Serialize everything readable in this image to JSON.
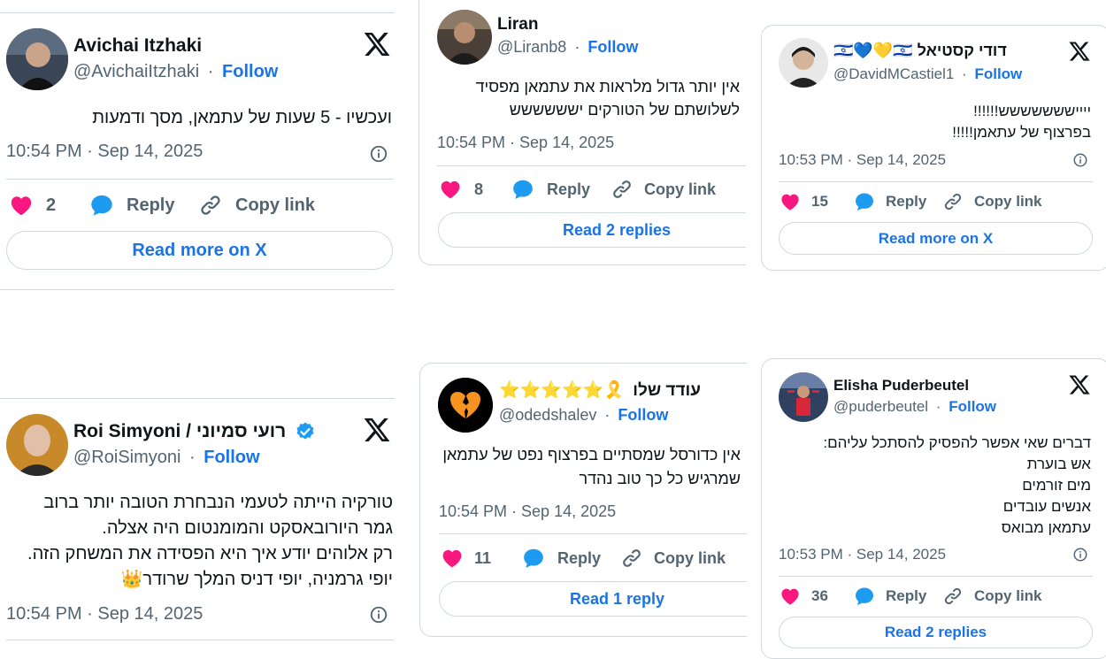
{
  "common": {
    "follow": "Follow",
    "dot": "·",
    "reply": "Reply",
    "copy_link": "Copy link"
  },
  "tweets": [
    {
      "name": "Avichai Itzhaki",
      "handle": "@AvichaiItzhaki",
      "lines": [
        "ועכשיו - 5 שעות של עתמאן, מסך ודמעות"
      ],
      "time": "10:54 PM · Sep 14, 2025",
      "likes": "2",
      "button": "Read more on X"
    },
    {
      "name": "Liran",
      "handle": "@Liranb8",
      "lines": [
        "אין יותר גדול מלראות את עתמאן מפסיד",
        "לשלושתם של הטורקים ישששששש"
      ],
      "time": "10:54 PM · Sep 14, 2025",
      "likes": "8",
      "button": "Read 2 replies"
    },
    {
      "name": "🇮🇱💙💛🇮🇱 דודי קסטיאל",
      "handle": "@DavidMCastiel1",
      "lines": [
        "ייייששששששש!!!!!!",
        "בפרצוף של עתאמן!!!!!"
      ],
      "time": "10:53 PM · Sep 14, 2025",
      "likes": "15",
      "button": "Read more on X"
    },
    {
      "name": "Roi Simyoni / רועי סמיוני",
      "handle": "@RoiSimyoni",
      "lines": [
        "טורקיה הייתה לטעמי הנבחרת הטובה יותר ברוב",
        "גמר היורובאסקט והמומנטום היה אצלה.",
        "רק אלוהים יודע איך היא הפסידה את המשחק הזה.",
        "יופי גרמניה, יופי דניס המלך שרודר👑"
      ],
      "time": "10:54 PM · Sep 14, 2025"
    },
    {
      "name": "עודד שלו",
      "name_prefix": "⭐⭐⭐⭐⭐🎗️",
      "handle": "@odedshalev",
      "lines": [
        "אין כדורסל שמסתיים בפרצוף נפט של עתמאן",
        "שמרגיש כל כך טוב נהדר"
      ],
      "time": "10:54 PM · Sep 14, 2025",
      "likes": "11",
      "button": "Read 1 reply"
    },
    {
      "name": "Elisha Puderbeutel",
      "handle": "@puderbeutel",
      "lines": [
        "דברים שאי אפשר להפסיק להסתכל עליהם:",
        "אש בוערת",
        "מים זורמים",
        "אנשים עובדים",
        "עתמאן מבואס"
      ],
      "time": "10:53 PM · Sep 14, 2025",
      "likes": "36",
      "button": "Read 2 replies"
    }
  ],
  "colors": {
    "follow": "#1a73e8",
    "heart": "#f91880",
    "reply_bubble": "#1d9bf0",
    "border": "#cfd9de",
    "muted": "#536471",
    "verified": "#1d9bf0"
  }
}
